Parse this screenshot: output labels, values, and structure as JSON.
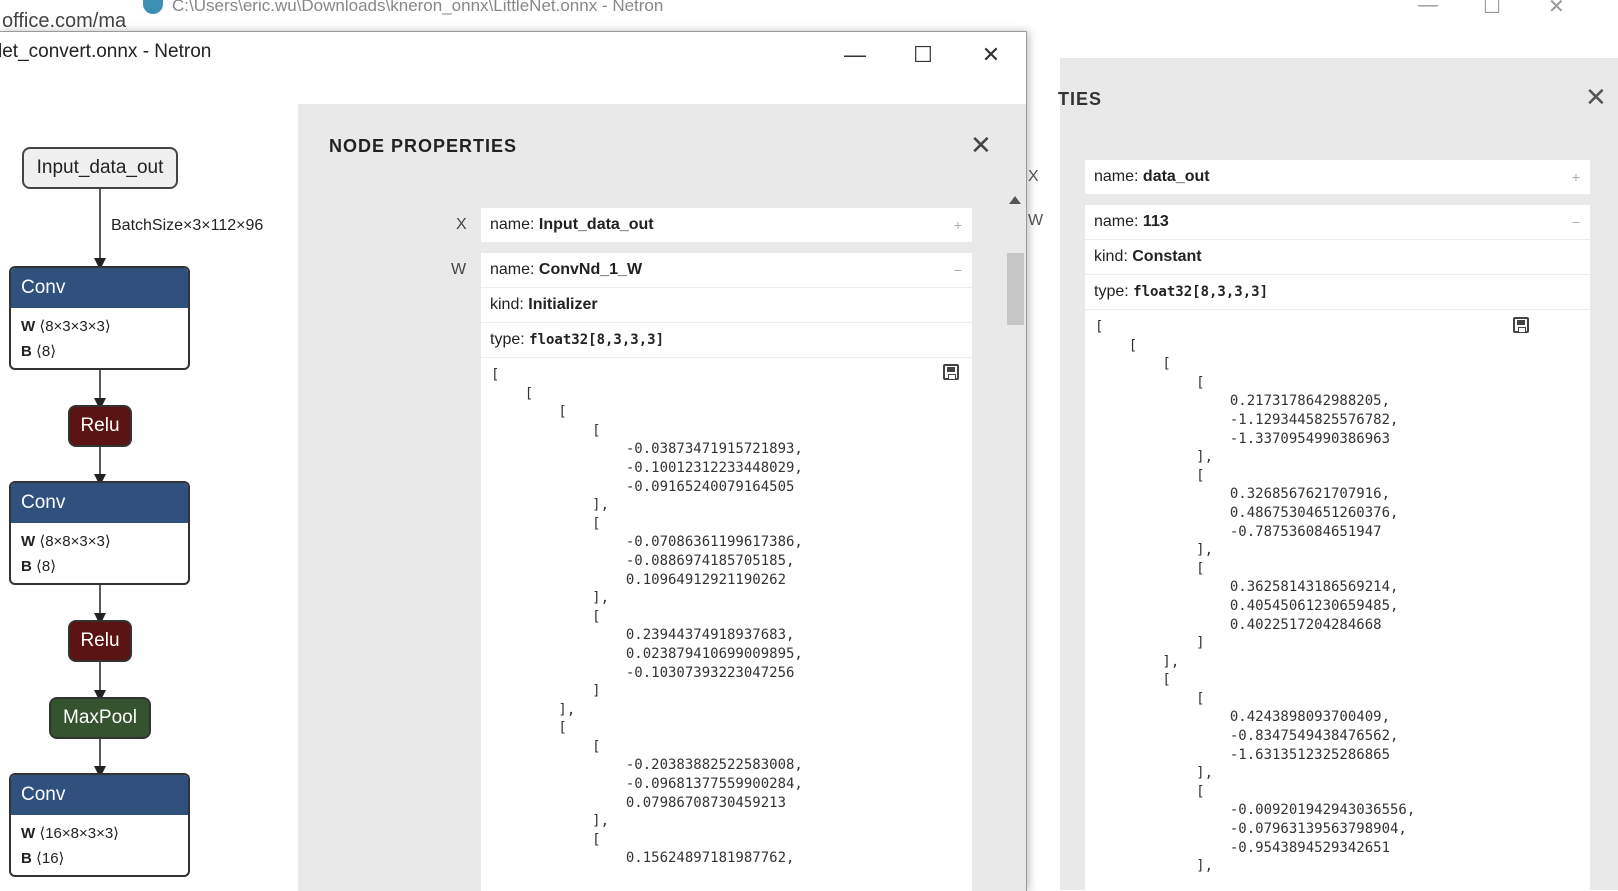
{
  "background_window": {
    "left_strip_text": "office.com/ma",
    "title": "C:\\Users\\eric.wu\\Downloads\\kneron_onnx\\LittleNet.onnx - Netron",
    "minimize": "—",
    "maximize": "☐",
    "close": "✕",
    "sidebar": {
      "title_fragment": "TIES",
      "close": "✕",
      "inputs": [
        {
          "letter": "X",
          "name_label": "name:",
          "name_value": "data_out",
          "expand": "+"
        },
        {
          "letter": "W",
          "name_label": "name:",
          "name_value": "113",
          "expand": "−",
          "kind_label": "kind:",
          "kind_value": "Constant",
          "type_label": "type:",
          "type_value": "float32[8,3,3,3]",
          "tensor_text": "[\n    [\n        [\n            [\n                0.2173178642988205,\n                -1.1293445825576782,\n                -1.3370954990386963\n            ],\n            [\n                0.3268567621707916,\n                0.48675304651260376,\n                -0.787536084651947\n            ],\n            [\n                0.36258143186569214,\n                0.40545061230659485,\n                0.4022517204284668\n            ]\n        ],\n        [\n            [\n                0.4243898093700409,\n                -0.8347549438476562,\n                -1.6313512325286865\n            ],\n            [\n                -0.009201942943036556,\n                -0.07963139563798904,\n                -0.9543894529342651\n            ],"
        }
      ]
    }
  },
  "foreground_window": {
    "title": "let_convert.onnx - Netron",
    "minimize": "—",
    "maximize": "☐",
    "close": "✕",
    "graph": {
      "input_node": "Input_data_out",
      "edge_label": "BatchSize×3×112×96",
      "nodes": [
        {
          "op": "Conv",
          "w_label": "W",
          "w_shape": "⟨8×3×3×3⟩",
          "b_label": "B",
          "b_shape": "⟨8⟩"
        },
        {
          "op": "Relu"
        },
        {
          "op": "Conv",
          "w_label": "W",
          "w_shape": "⟨8×8×3×3⟩",
          "b_label": "B",
          "b_shape": "⟨8⟩"
        },
        {
          "op": "Relu"
        },
        {
          "op": "MaxPool"
        },
        {
          "op": "Conv",
          "w_label": "W",
          "w_shape": "⟨16×8×3×3⟩",
          "b_label": "B",
          "b_shape": "⟨16⟩"
        }
      ]
    },
    "sidebar": {
      "title": "NODE PROPERTIES",
      "close": "✕",
      "inputs": [
        {
          "letter": "X",
          "name_label": "name:",
          "name_value": "Input_data_out",
          "expand": "+"
        },
        {
          "letter": "W",
          "name_label": "name:",
          "name_value": "ConvNd_1_W",
          "expand": "−",
          "kind_label": "kind:",
          "kind_value": "Initializer",
          "type_label": "type:",
          "type_value": "float32[8,3,3,3]",
          "tensor_text": "[\n    [\n        [\n            [\n                -0.03873471915721893,\n                -0.10012312233448029,\n                -0.09165240079164505\n            ],\n            [\n                -0.07086361199617386,\n                -0.0886974185705185,\n                0.10964912921190262\n            ],\n            [\n                0.23944374918937683,\n                0.023879410699009895,\n                -0.10307393223047256\n            ]\n        ],\n        [\n            [\n                -0.20383882522583008,\n                -0.09681377559900284,\n                0.07986708730459213\n            ],\n            [\n                0.15624897181987762,"
        }
      ]
    }
  }
}
